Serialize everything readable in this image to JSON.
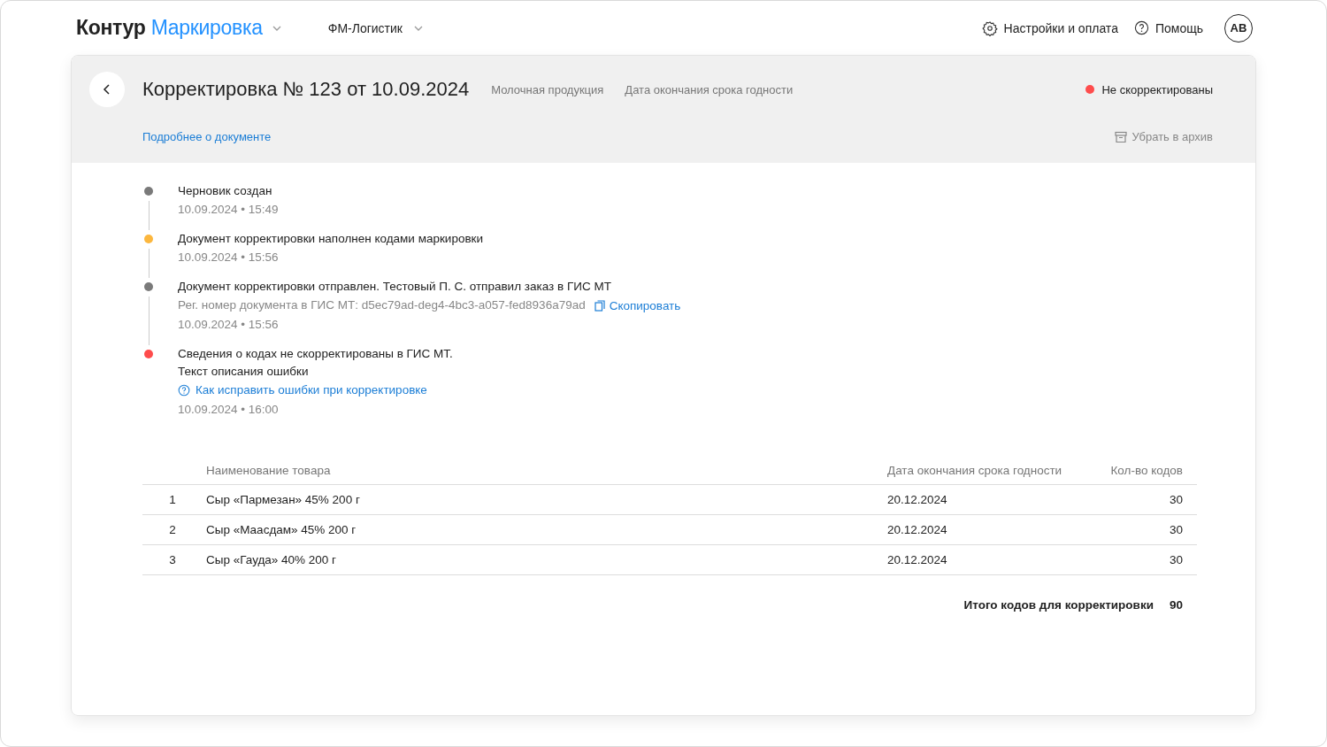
{
  "header": {
    "brand": "Контур",
    "product": "Маркировка",
    "organization": "ФМ-Логистик",
    "settings": "Настройки и оплата",
    "help": "Помощь",
    "avatar": "АВ"
  },
  "document": {
    "title": "Корректировка № 123 от 10.09.2024",
    "tags": [
      "Молочная продукция",
      "Дата окончания срока годности"
    ],
    "status": {
      "label": "Не скорректированы",
      "color": "#fe4c4c"
    },
    "details_link": "Подробнее о документе",
    "archive": "Убрать в архив"
  },
  "timeline": [
    {
      "color": "#7a7a7a",
      "lines": [
        "Черновик создан"
      ],
      "time": "10.09.2024 • 15:49"
    },
    {
      "color": "#fcb73e",
      "lines": [
        "Документ корректировки наполнен кодами маркировки"
      ],
      "time": "10.09.2024 • 15:56"
    },
    {
      "color": "#7a7a7a",
      "lines": [
        "Документ корректировки отправлен. Тестовый П. С. отправил заказ в ГИС МТ"
      ],
      "reg_number": "Рег. номер документа в ГИС МТ: d5ec79ad-deg4-4bc3-a057-fed8936a79ad",
      "copy": "Скопировать",
      "time": "10.09.2024 • 15:56"
    },
    {
      "color": "#fe4c4c",
      "lines": [
        "Сведения о кодах не скорректированы в ГИС МТ.",
        "Текст описания ошибки"
      ],
      "help_link": "Как исправить ошибки при корректировке",
      "time": "10.09.2024 • 16:00"
    }
  ],
  "table": {
    "columns": [
      "Наименование товара",
      "Дата окончания срока годности",
      "Кол-во кодов"
    ],
    "rows": [
      {
        "index": "1",
        "name": "Сыр «Пармезан» 45% 200 г",
        "date": "20.12.2024",
        "count": "30"
      },
      {
        "index": "2",
        "name": "Сыр «Маасдам» 45% 200 г",
        "date": "20.12.2024",
        "count": "30"
      },
      {
        "index": "3",
        "name": "Сыр «Гауда» 40% 200 г",
        "date": "20.12.2024",
        "count": "30"
      }
    ],
    "total_label": "Итого кодов для корректировки",
    "total_value": "90"
  }
}
